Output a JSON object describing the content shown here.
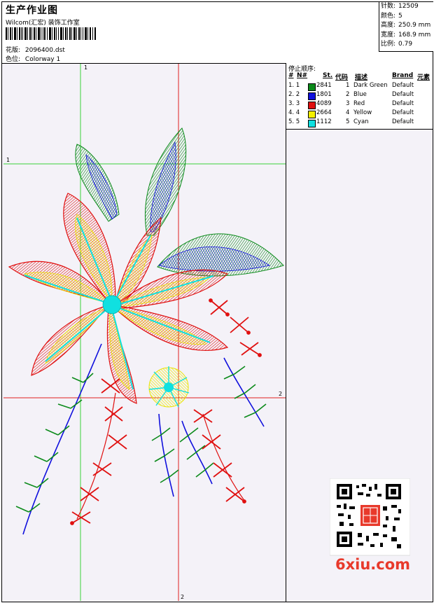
{
  "header": {
    "title": "生产作业图",
    "subtitle": "Wilcom(汇宏) 装饰工作室",
    "design_label": "花版:",
    "design_file": "2096400.dst",
    "color_label": "色位:",
    "colorway": "Colorway 1"
  },
  "stats": [
    {
      "label": "针数:",
      "value": "12509"
    },
    {
      "label": "颜色:",
      "value": "5"
    },
    {
      "label": "高度:",
      "value": "250.9 mm"
    },
    {
      "label": "宽度:",
      "value": "168.9 mm"
    },
    {
      "label": "比例:",
      "value": "0.79"
    }
  ],
  "stops": {
    "title": "停止顺序:",
    "headers": [
      "#",
      "N#",
      "St.",
      "代码",
      "描述",
      "Brand",
      "元素"
    ],
    "rows": [
      {
        "num": "1. 1",
        "color": "#0b8a1a",
        "stitches": "2841",
        "code": "1",
        "desc": "Dark Green",
        "brand": "Default"
      },
      {
        "num": "2. 2",
        "color": "#1010dd",
        "stitches": "1801",
        "code": "2",
        "desc": "Blue",
        "brand": "Default"
      },
      {
        "num": "3. 3",
        "color": "#e01010",
        "stitches": "4089",
        "code": "3",
        "desc": "Red",
        "brand": "Default"
      },
      {
        "num": "4. 4",
        "color": "#f4f000",
        "stitches": "2664",
        "code": "4",
        "desc": "Yellow",
        "brand": "Default"
      },
      {
        "num": "5. 5",
        "color": "#10e0e0",
        "stitches": "1112",
        "code": "5",
        "desc": "Cyan",
        "brand": "Default"
      }
    ]
  },
  "guides": {
    "v1": "1",
    "h1": "1",
    "h2": "2",
    "v2": "2"
  },
  "watermark": "6xiu.com"
}
